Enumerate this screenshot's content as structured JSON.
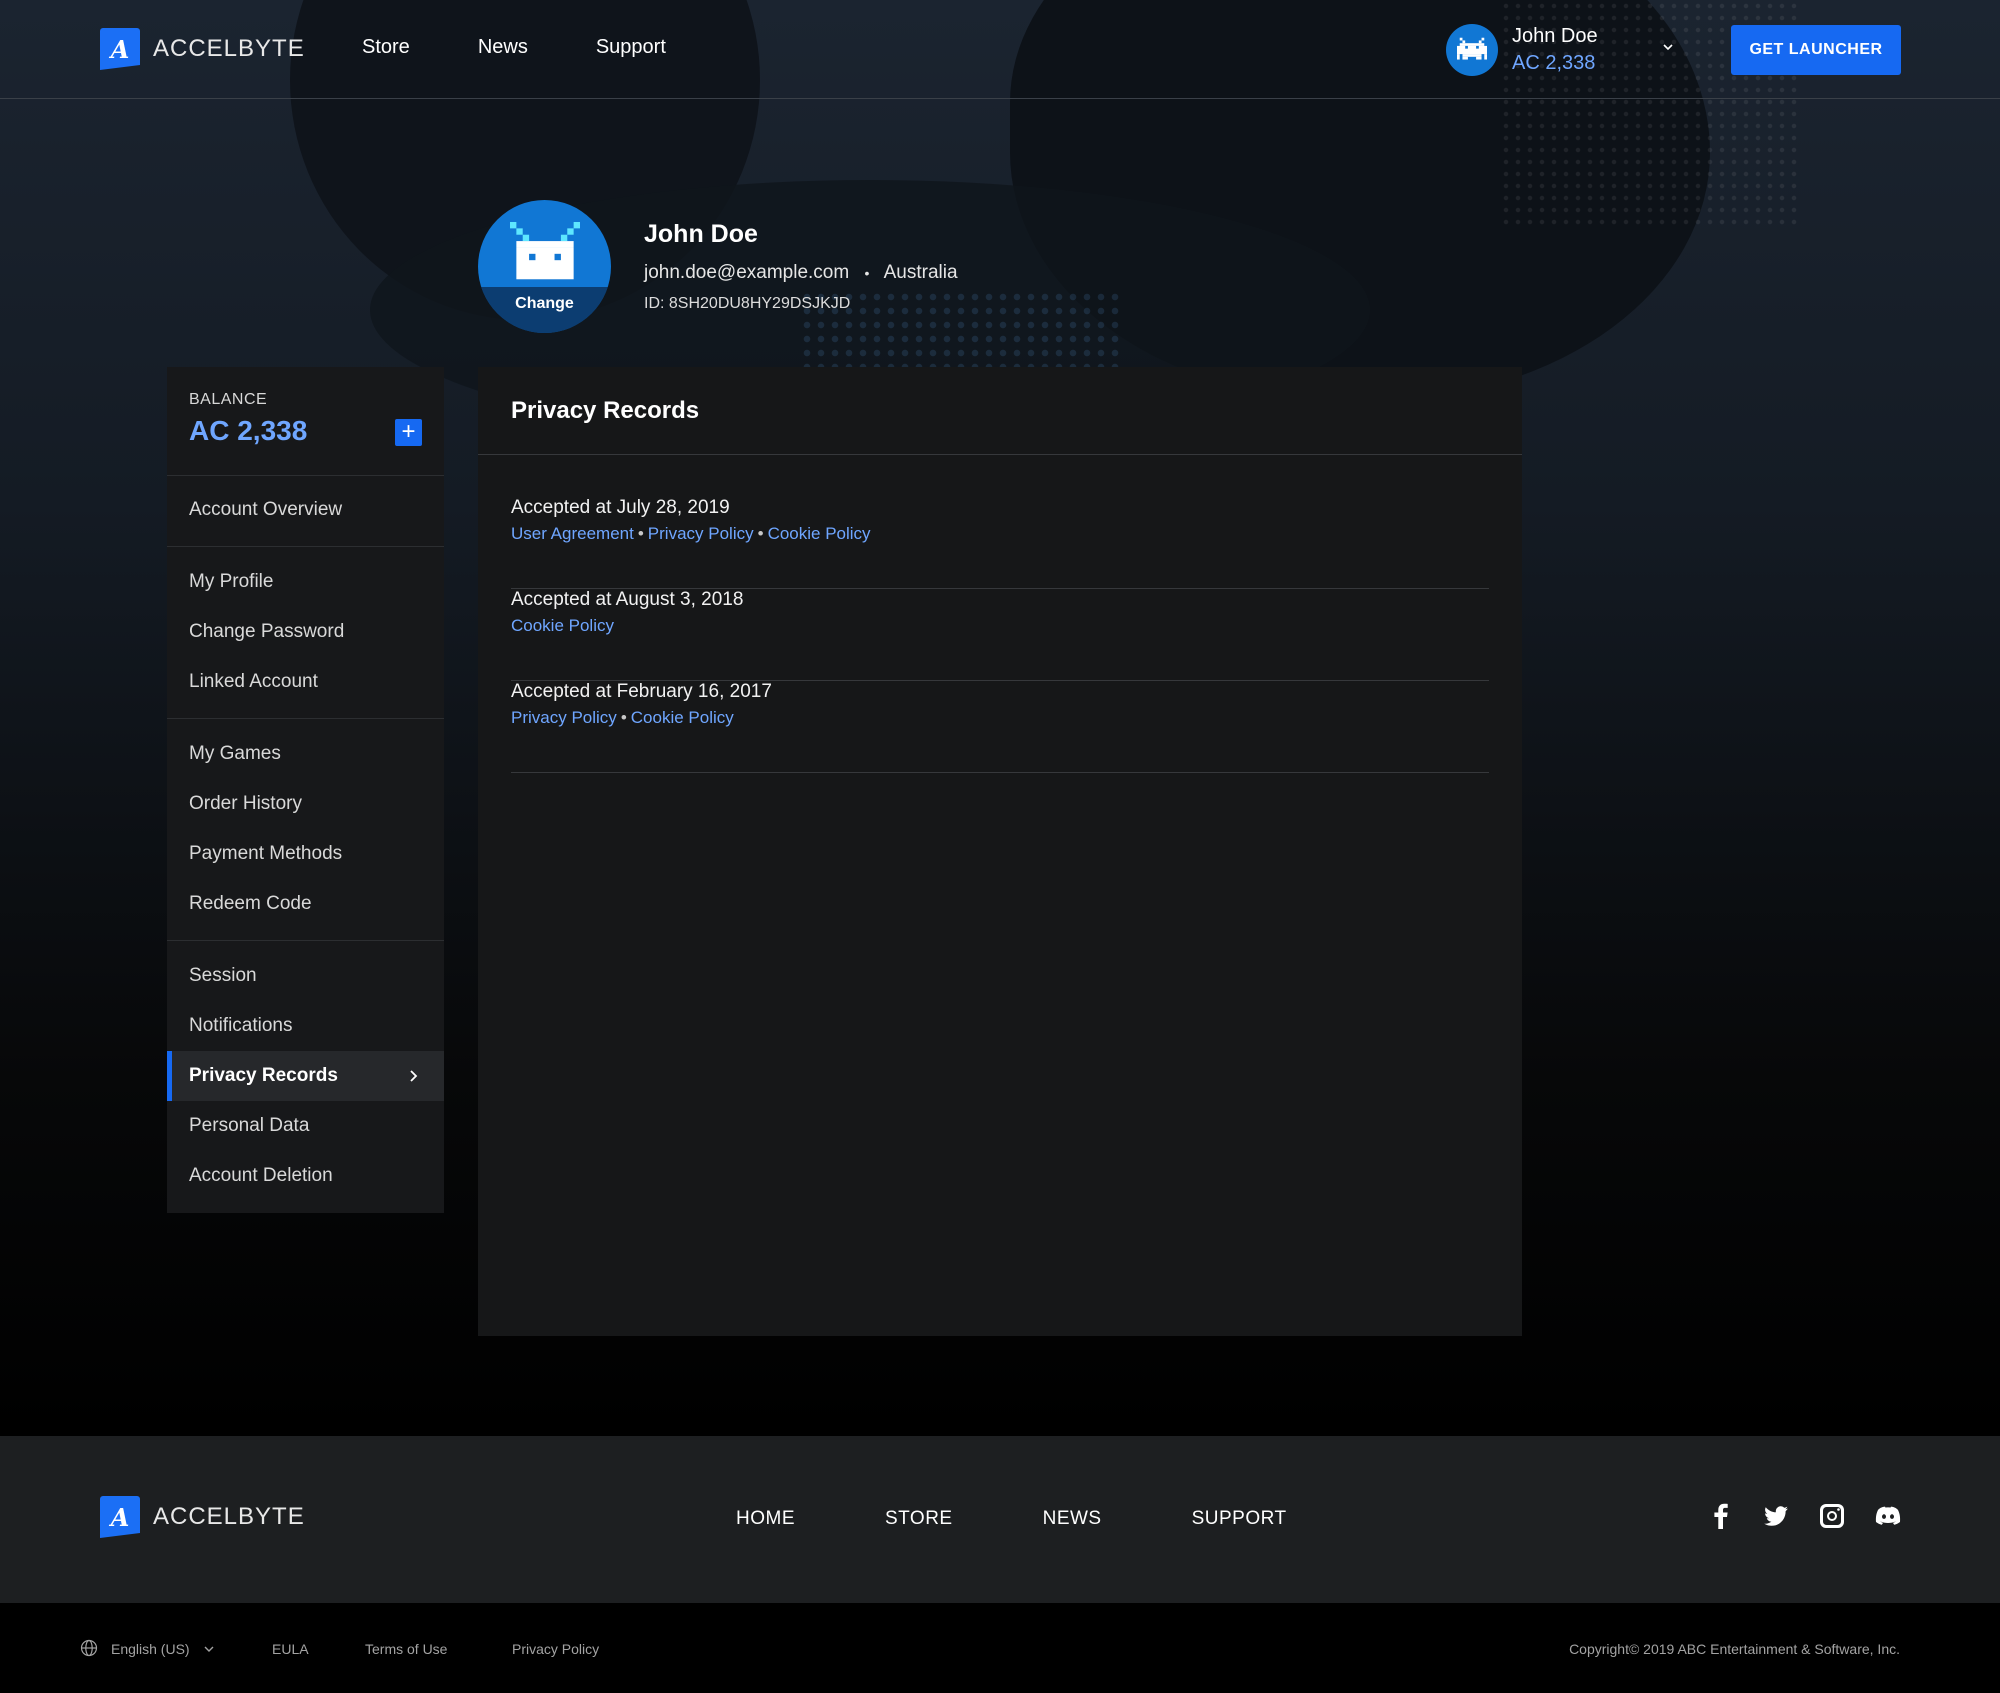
{
  "brand": {
    "name": "ACCELBYTE",
    "logo_glyph": "A"
  },
  "header": {
    "nav": [
      "Store",
      "News",
      "Support"
    ],
    "user_name": "John Doe",
    "user_balance": "AC 2,338",
    "launcher_button": "GET LAUNCHER"
  },
  "profile": {
    "name": "John Doe",
    "email": "john.doe@example.com",
    "separator": "•",
    "country": "Australia",
    "id": "ID: 8SH20DU8HY29DSJKJD",
    "change_label": "Change"
  },
  "sidebar": {
    "balance_label": "BALANCE",
    "balance_value": "AC 2,338",
    "add_label": "+",
    "items": [
      "Account Overview",
      "My Profile",
      "Change Password",
      "Linked Account",
      "My Games",
      "Order History",
      "Payment Methods",
      "Redeem Code",
      "Session",
      "Notifications",
      "Privacy Records",
      "Personal Data",
      "Account Deletion"
    ],
    "active_item": "Privacy Records"
  },
  "main": {
    "title": "Privacy Records",
    "records": [
      {
        "date": "Accepted at July 28, 2019",
        "links": [
          "User Agreement",
          "Privacy Policy",
          "Cookie Policy"
        ]
      },
      {
        "date": "Accepted at August 3, 2018",
        "links": [
          "Cookie Policy"
        ]
      },
      {
        "date": "Accepted at February 16, 2017",
        "links": [
          "Privacy Policy",
          "Cookie Policy"
        ]
      }
    ]
  },
  "footer": {
    "nav": [
      "HOME",
      "STORE",
      "NEWS",
      "SUPPORT"
    ],
    "social_icons": [
      "facebook-icon",
      "twitter-icon",
      "instagram-icon",
      "discord-icon"
    ],
    "language": "English (US)",
    "links": [
      "EULA",
      "Terms of Use",
      "Privacy Policy"
    ],
    "copyright": "Copyright© 2019 ABC Entertainment & Software, Inc."
  },
  "colors": {
    "accent": "#1669f2",
    "link": "#6fa6ff",
    "panel": "#161718",
    "avatar": "#1177d4"
  }
}
